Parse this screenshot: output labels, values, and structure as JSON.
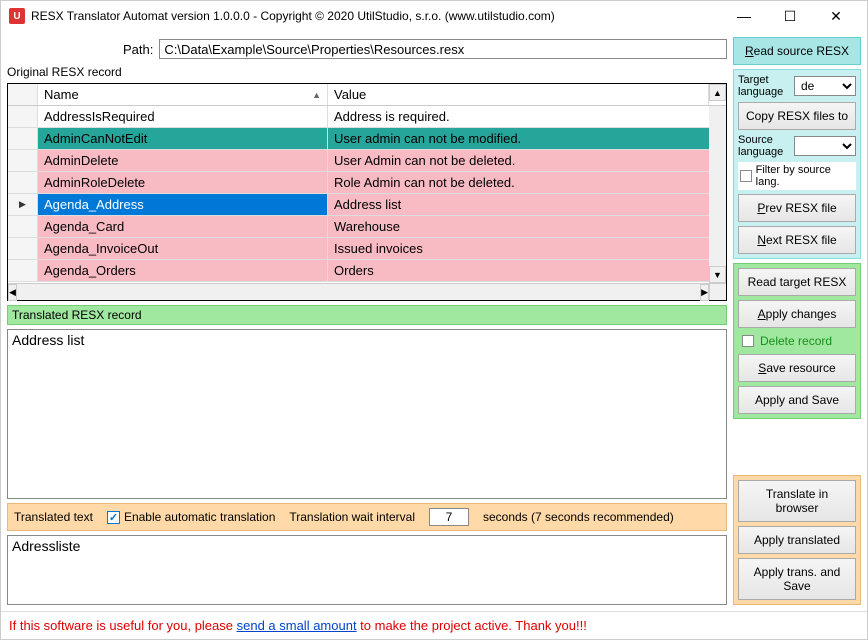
{
  "window": {
    "title": "RESX Translator Automat version 1.0.0.0 - Copyright © 2020 UtilStudio, s.r.o. (www.utilstudio.com)"
  },
  "toolbar": {
    "path_label": "Path:",
    "path_value": "C:\\Data\\Example\\Source\\Properties\\Resources.resx",
    "original_label": "Original RESX record",
    "read_source": "Read source RESX"
  },
  "grid": {
    "col_name": "Name",
    "col_value": "Value",
    "rows": [
      {
        "name": "AddressIsRequired",
        "value": "Address is required.",
        "cls": "row-white"
      },
      {
        "name": "AdminCanNotEdit",
        "value": "User admin can not be modified.",
        "cls": "row-teal"
      },
      {
        "name": "AdminDelete",
        "value": "User Admin can not be deleted.",
        "cls": "row-pink"
      },
      {
        "name": "AdminRoleDelete",
        "value": "Role Admin can not be deleted.",
        "cls": "row-pink"
      },
      {
        "name": "Agenda_Address",
        "value": "Address list",
        "cls": "row-pink row-selected"
      },
      {
        "name": "Agenda_Card",
        "value": "Warehouse",
        "cls": "row-pink"
      },
      {
        "name": "Agenda_InvoiceOut",
        "value": "Issued invoices",
        "cls": "row-pink"
      },
      {
        "name": "Agenda_Orders",
        "value": "Orders",
        "cls": "row-pink"
      }
    ]
  },
  "translated_section": {
    "label": "Translated RESX record",
    "text": "Address list"
  },
  "transtext_section": {
    "label": "Translated text",
    "enable_auto": "Enable automatic translation",
    "interval_label": "Translation wait interval",
    "interval_value": "7",
    "interval_suffix": "seconds (7 seconds recommended)",
    "text": "Adressliste"
  },
  "side": {
    "target_lang_label": "Target language",
    "target_lang_value": "de",
    "copy_resx": "Copy RESX files to",
    "source_lang_label": "Source language",
    "source_lang_value": "",
    "filter_label": "Filter by source lang.",
    "prev_file": "Prev RESX file",
    "next_file": "Next RESX file",
    "read_target": "Read target RESX",
    "apply_changes": "Apply changes",
    "delete_record": "Delete record",
    "save_resource": "Save resource",
    "apply_and_save": "Apply and Save",
    "translate_browser": "Translate in browser",
    "apply_translated": "Apply translated",
    "apply_trans_save": "Apply trans. and Save"
  },
  "footer": {
    "pre": "If this software is useful for you, please ",
    "link": "send a small amount",
    "post": " to make the project active. Thank you!!!"
  }
}
